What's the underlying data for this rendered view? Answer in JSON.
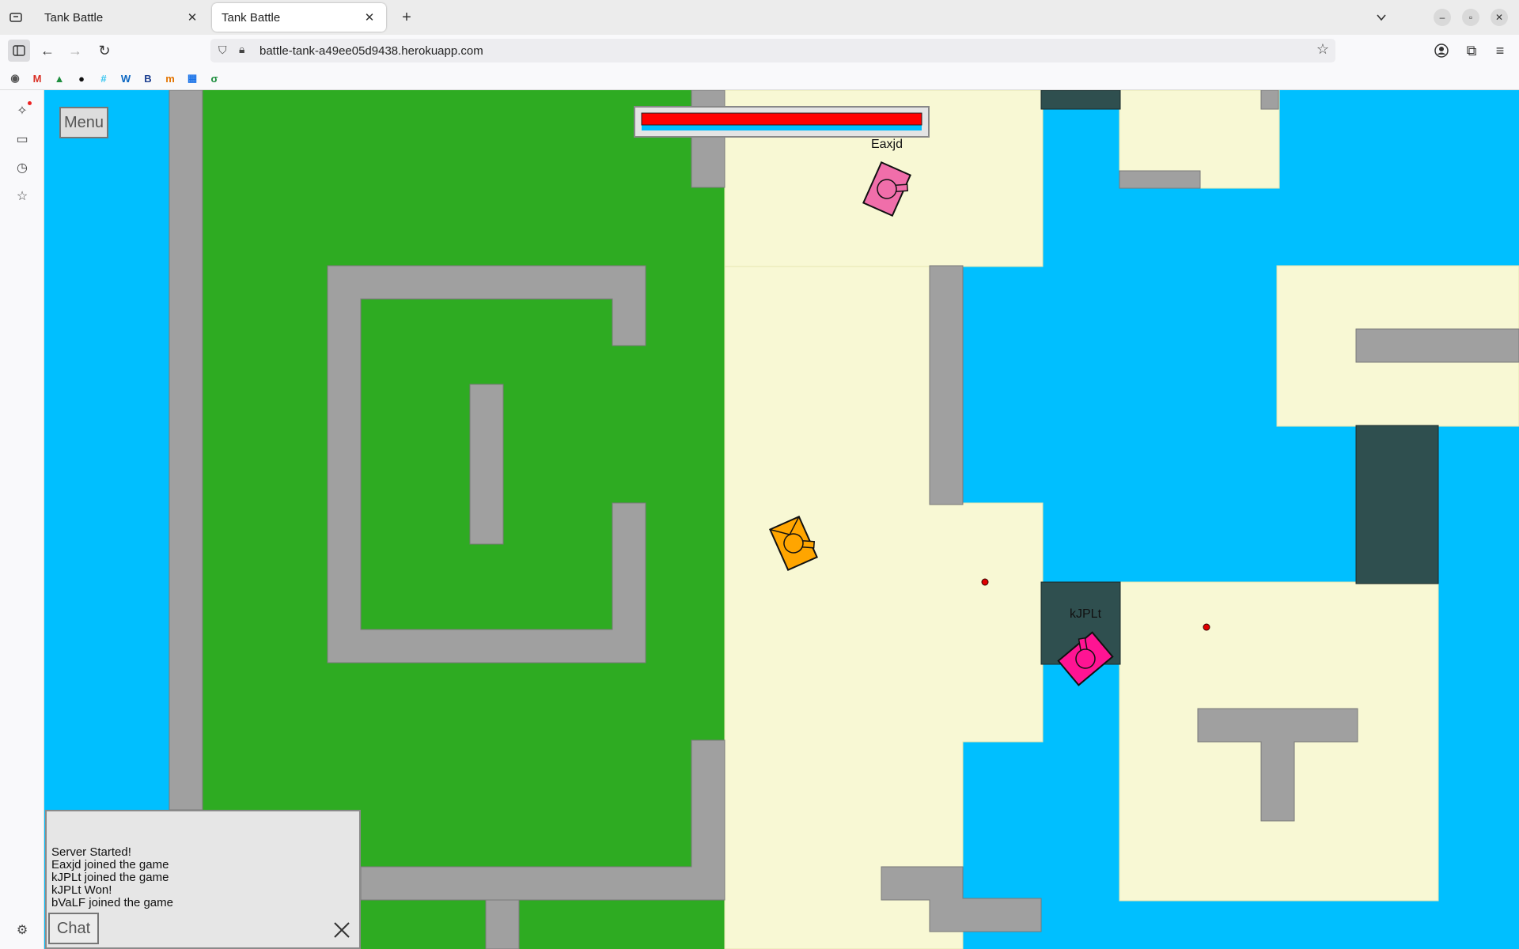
{
  "browser": {
    "tabs": [
      {
        "title": "Tank Battle",
        "active": false
      },
      {
        "title": "Tank Battle",
        "active": true
      }
    ],
    "new_tab_label": "+",
    "url": "battle-tank-a49ee05d9438.herokuapp.com",
    "bookmarks": [
      "chrome-icon",
      "gmail-icon",
      "drive-icon",
      "github-icon",
      "slack-icon",
      "w-icon",
      "B",
      "m-icon",
      "calendar-icon",
      "link-icon"
    ]
  },
  "game": {
    "menu_label": "Menu",
    "health": {
      "health_fraction": 1.0,
      "bar_color": "#ff0000",
      "secondary_color": "#00bfff"
    },
    "players": [
      {
        "name": "Eaxjd",
        "color": "#f06eaa"
      },
      {
        "name": "kJPLt",
        "color": "#ff1493"
      },
      {
        "name": "",
        "color": "#ffa500"
      }
    ],
    "colors": {
      "water": "#00bfff",
      "grass": "#2eab22",
      "sand": "#f8f8d4",
      "wall": "#a0a0a0",
      "dark_block": "#2f4f4f"
    },
    "chat": {
      "messages": [
        "Server Started!",
        "Eaxjd joined the game",
        "kJPLt joined the game",
        "kJPLt Won!",
        "bVaLF joined the game"
      ],
      "chat_button_label": "Chat"
    }
  }
}
